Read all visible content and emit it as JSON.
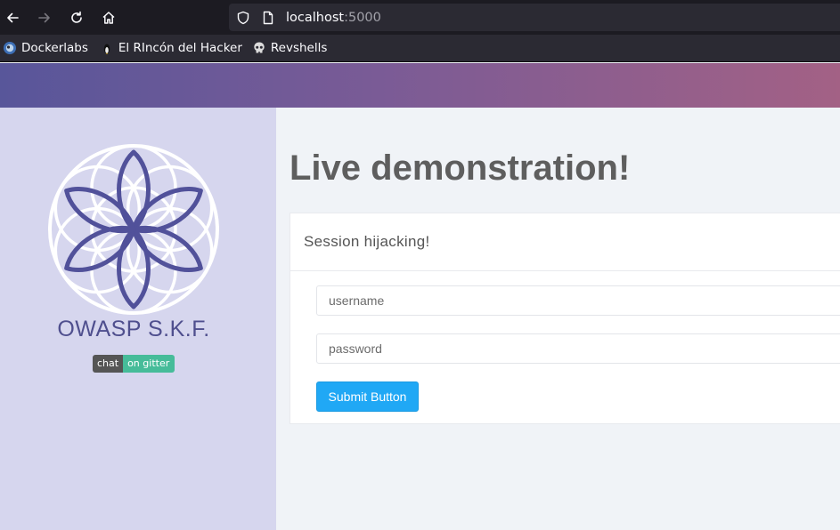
{
  "browser": {
    "url_host": "localhost",
    "url_port": ":5000",
    "bookmarks": [
      {
        "label": "Dockerlabs",
        "icon": "dockerlabs-icon"
      },
      {
        "label": "El RIncón del Hacker",
        "icon": "penguin-icon"
      },
      {
        "label": "Revshells",
        "icon": "skull-icon"
      }
    ]
  },
  "sidebar": {
    "title": "OWASP S.K.F.",
    "badge_left": "chat",
    "badge_right": "on gitter"
  },
  "main": {
    "title": "Live demonstration!",
    "card_title": "Session hijacking!",
    "username_placeholder": "username",
    "password_placeholder": "password",
    "submit_label": "Submit Button"
  },
  "colors": {
    "accent": "#20a8f5",
    "sidebar_bg": "#d6d6ee",
    "logo": "#51519a",
    "badge_green": "#46bc99"
  }
}
